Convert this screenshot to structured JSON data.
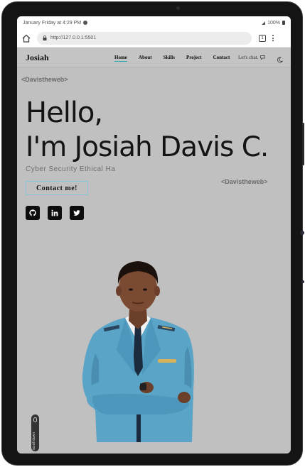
{
  "status_bar": {
    "left_text": "January Friday at 4:29 PM",
    "right_text": "100%"
  },
  "browser": {
    "url": "http://127.0.0.1:5501",
    "tab_count": "1"
  },
  "site": {
    "logo": "Josiah",
    "nav": [
      {
        "label": "Home",
        "active": true
      },
      {
        "label": "About"
      },
      {
        "label": "Skills"
      },
      {
        "label": "Project"
      },
      {
        "label": "Contact"
      }
    ],
    "chat_label": "Let's chat."
  },
  "hero": {
    "tag_top": "<Davistheweb>",
    "greeting": "Hello,",
    "name_line": "I'm Josiah Davis C.",
    "subtitle": "Cyber Security Ethical Ha",
    "tag_side": "<Davistheweb>",
    "cta": "Contact me!",
    "socials": [
      "github-icon",
      "linkedin-icon",
      "twitter-icon"
    ]
  },
  "scroll_hint": "scroll down",
  "colors": {
    "accent": "#2fa8b5",
    "page_bg": "#c0c0c0",
    "jacket": "#5aa4c8"
  }
}
